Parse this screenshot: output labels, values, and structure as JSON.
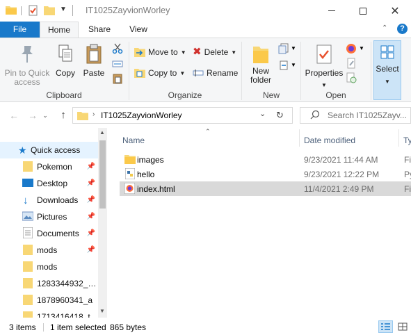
{
  "window": {
    "title": "IT1025ZayvionWorley",
    "minimize_icon": "minimize-icon",
    "maximize_icon": "maximize-icon",
    "close_icon": "close-icon"
  },
  "ribbon_tabs": [
    "File",
    "Home",
    "Share",
    "View"
  ],
  "ribbon": {
    "clipboard": {
      "pin_label_1": "Pin to Quick",
      "pin_label_2": "access",
      "copy": "Copy",
      "paste": "Paste",
      "group": "Clipboard"
    },
    "organize": {
      "move_to": "Move to",
      "copy_to": "Copy to",
      "delete": "Delete",
      "rename": "Rename",
      "group": "Organize"
    },
    "new": {
      "new_folder_1": "New",
      "new_folder_2": "folder",
      "group": "New"
    },
    "open": {
      "properties": "Properties",
      "group": "Open"
    },
    "select": {
      "select": "Select"
    }
  },
  "address": {
    "path": "IT1025ZayvionWorley",
    "search_placeholder": "Search IT1025Zayv..."
  },
  "nav_pane": {
    "quick_access": "Quick access",
    "items": [
      {
        "label": "Pokemon",
        "icon": "folder-icon",
        "pinned": true
      },
      {
        "label": "Desktop",
        "icon": "desktop-icon",
        "pinned": true
      },
      {
        "label": "Downloads",
        "icon": "download-icon",
        "pinned": true
      },
      {
        "label": "Pictures",
        "icon": "pictures-icon",
        "pinned": true
      },
      {
        "label": "Documents",
        "icon": "documents-icon",
        "pinned": true
      },
      {
        "label": "mods",
        "icon": "folder-icon",
        "pinned": true
      },
      {
        "label": "mods",
        "icon": "folder-icon",
        "pinned": false
      },
      {
        "label": "1283344932_…",
        "icon": "folder-icon",
        "pinned": false
      },
      {
        "label": "1878960341_a",
        "icon": "folder-icon",
        "pinned": false
      },
      {
        "label": "1713416418_t",
        "icon": "folder-icon",
        "pinned": false
      }
    ]
  },
  "file_list": {
    "columns": [
      "Name",
      "Date modified",
      "Ty"
    ],
    "rows": [
      {
        "name": "images",
        "date": "9/23/2021 11:44 AM",
        "type": "Fi",
        "icon": "folder-icon",
        "selected": false
      },
      {
        "name": "hello",
        "date": "9/23/2021 12:22 PM",
        "type": "Py",
        "icon": "python-file-icon",
        "selected": false
      },
      {
        "name": "index.html",
        "date": "11/4/2021 2:49 PM",
        "type": "Fi",
        "icon": "firefox-html-icon",
        "selected": true
      }
    ]
  },
  "status": {
    "items": "3 items",
    "selected": "1 item selected",
    "size": "865 bytes"
  },
  "colors": {
    "accent": "#1979ca",
    "selection": "#d9d9d9",
    "folder": "#f8d775"
  }
}
